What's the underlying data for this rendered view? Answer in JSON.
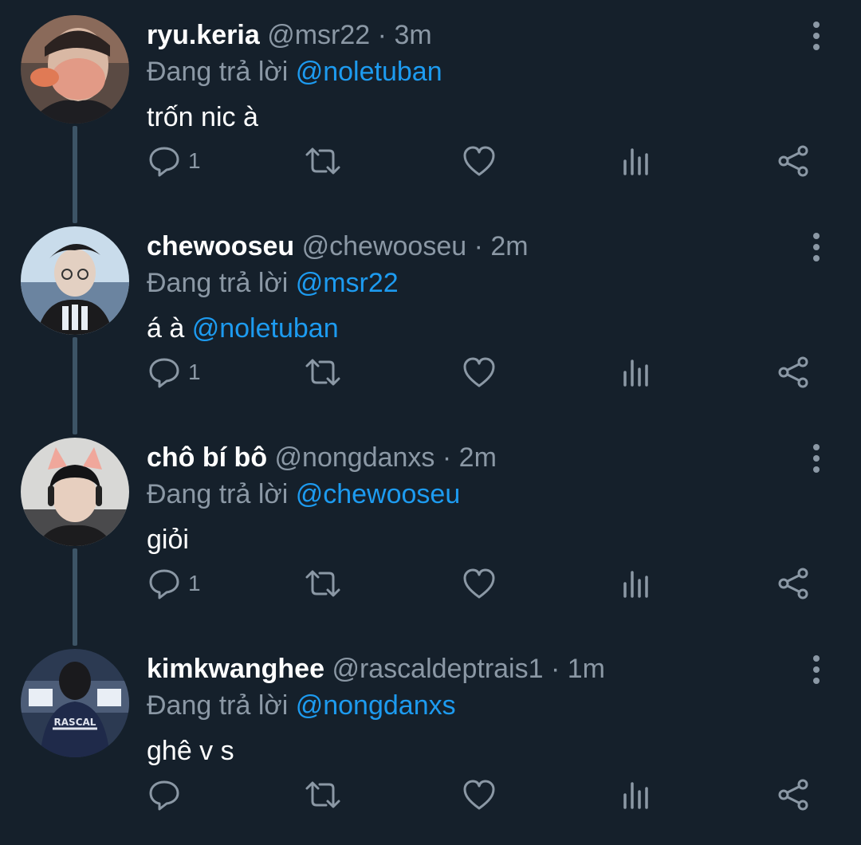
{
  "colors": {
    "background": "#15202b",
    "text": "#ffffff",
    "muted": "#8b98a5",
    "link": "#1d9bf0",
    "thread_line": "#3d5466"
  },
  "tweets": [
    {
      "display_name": "ryu.keria",
      "handle": "@msr22",
      "separator": "·",
      "time": "3m",
      "reply_prefix": "Đang trả lời",
      "reply_to": "@noletuban",
      "text": "trốn nic à",
      "reply_count": "1"
    },
    {
      "display_name": "chewooseu",
      "handle": "@chewooseu",
      "separator": "·",
      "time": "2m",
      "reply_prefix": "Đang trả lời",
      "reply_to": "@msr22",
      "text_pre": "á à",
      "text_mention": "@noletuban",
      "reply_count": "1"
    },
    {
      "display_name": "chô bí bô",
      "handle": "@nongdanxs",
      "separator": "·",
      "time": "2m",
      "reply_prefix": "Đang trả lời",
      "reply_to": "@chewooseu",
      "text": "giỏi",
      "reply_count": "1"
    },
    {
      "display_name": "kimkwanghee",
      "handle": "@rascaldeptrais1",
      "separator": "·",
      "time": "1m",
      "reply_prefix": "Đang trả lời",
      "reply_to": "@nongdanxs",
      "text": "ghê v s",
      "reply_count": ""
    }
  ],
  "icons": [
    "reply-icon",
    "retweet-icon",
    "like-icon",
    "analytics-icon",
    "share-icon",
    "more-options-icon"
  ]
}
